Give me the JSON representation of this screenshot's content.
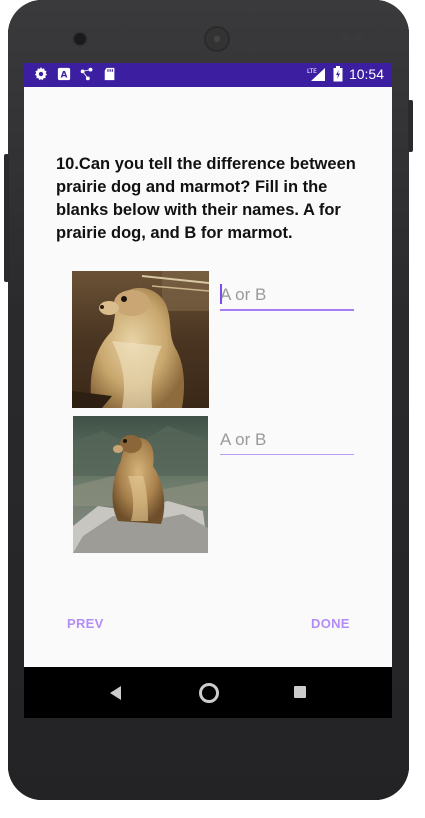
{
  "status_bar": {
    "time": "10:54",
    "network": "LTE",
    "left_icons": [
      "settings-gear-icon",
      "a-notification-icon",
      "share-dots-icon",
      "sd-card-icon"
    ]
  },
  "question": {
    "text": "10.Can you tell the difference between prairie dog and marmot? Fill in the blanks below with their names. A for prairie dog, and B for marmot."
  },
  "answers": [
    {
      "placeholder": "A or B",
      "value": "",
      "image": "prairie-dog-photo"
    },
    {
      "placeholder": "A or B",
      "value": "",
      "image": "marmot-photo"
    }
  ],
  "buttons": {
    "prev": "PREV",
    "done": "DONE"
  },
  "colors": {
    "status_bar": "#3c1fa0",
    "accent": "#a77df5",
    "button_text": "#b38ef8",
    "screen_bg": "#fafafa"
  }
}
